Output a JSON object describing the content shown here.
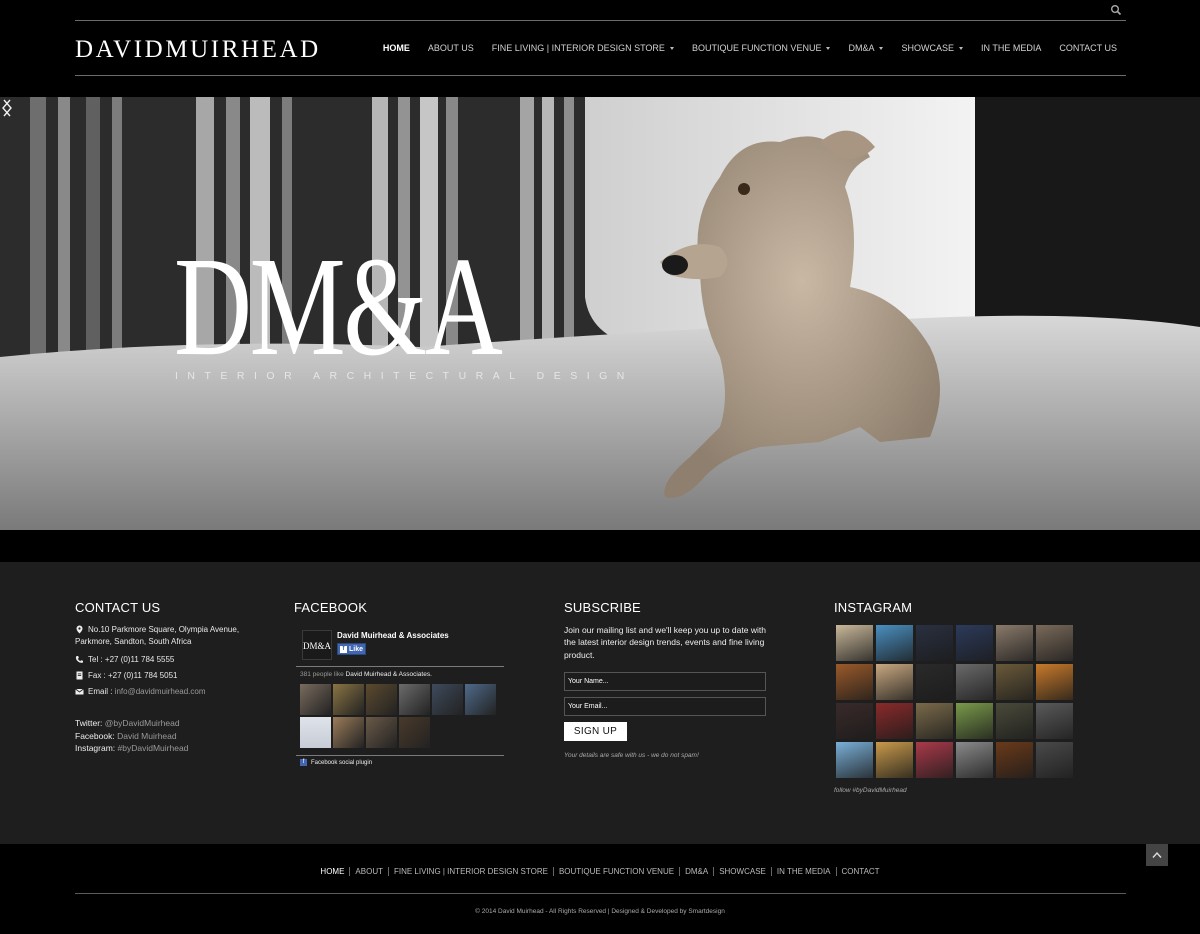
{
  "header": {
    "logo": "DAVIDMUIRHEAD",
    "nav": [
      {
        "label": "HOME",
        "active": true,
        "dropdown": false
      },
      {
        "label": "ABOUT US",
        "active": false,
        "dropdown": false
      },
      {
        "label": "FINE LIVING | INTERIOR DESIGN STORE",
        "active": false,
        "dropdown": true
      },
      {
        "label": "BOUTIQUE FUNCTION VENUE",
        "active": false,
        "dropdown": true
      },
      {
        "label": "DM&A",
        "active": false,
        "dropdown": true
      },
      {
        "label": "SHOWCASE",
        "active": false,
        "dropdown": true
      },
      {
        "label": "IN THE MEDIA",
        "active": false,
        "dropdown": false
      },
      {
        "label": "CONTACT US",
        "active": false,
        "dropdown": false
      }
    ]
  },
  "hero": {
    "title": "DM&A",
    "subtitle": "INTERIOR ARCHITECTURAL DESIGN"
  },
  "contact": {
    "title": "CONTACT US",
    "address": "No.10 Parkmore Square, Olympia Avenue,",
    "address2": "Parkmore, Sandton, South Africa",
    "tel": "Tel : +27 (0)11 784 5555",
    "fax": "Fax : +27 (0)11 784 5051",
    "email_label": "Email :",
    "email": "info@davidmuirhead.com",
    "twitter_label": "Twitter:",
    "twitter": "@byDavidMuirhead",
    "facebook_label": "Facebook:",
    "facebook": "David Muirhead",
    "instagram_label": "Instagram:",
    "instagram": "#byDavidMuirhead"
  },
  "facebook": {
    "title": "FACEBOOK",
    "logo_text": "DM&A",
    "page_name": "David Muirhead & Associates",
    "like_label": "Like",
    "count_text": "381 people like",
    "count_page": "David Muirhead & Associates.",
    "plugin_text": "Facebook social plugin",
    "face_colors": [
      "#7a6b5e",
      "#8a7444",
      "#5c4a2f",
      "#6b6b6b",
      "#3e4a5c",
      "#4f6a8a",
      "#c7ccd6",
      "#9c7c5a",
      "#6a5a48",
      "#4a3a2a"
    ]
  },
  "subscribe": {
    "title": "SUBSCRIBE",
    "text": "Join our mailing list and we'll keep you up to date with the latest interior design trends, events and fine living product.",
    "name_placeholder": "Your Name...",
    "email_placeholder": "Your Email...",
    "button": "SIGN UP",
    "note": "Your details are safe with us - we do not spam!"
  },
  "instagram": {
    "title": "INSTAGRAM",
    "follow": "follow #byDavidMuirhead",
    "tile_colors": [
      "#c9b89a",
      "#4a8fc0",
      "#2a3040",
      "#2c3a5a",
      "#8a7a6a",
      "#7a6a5a",
      "#9a5a2a",
      "#c8a880",
      "#2a2a2a",
      "#6a6a6a",
      "#6a5a3a",
      "#c87a2a",
      "#3a2a2a",
      "#8a2a2a",
      "#7a6a4a",
      "#7a9a4a",
      "#4a4a3a",
      "#5a5a5a",
      "#7ab0d8",
      "#c89a4a",
      "#aa3a4a",
      "#8a8a8a",
      "#6a3a1a",
      "#4a4a4a"
    ]
  },
  "footer": {
    "nav": [
      {
        "label": "HOME",
        "active": true
      },
      {
        "label": "ABOUT",
        "active": false
      },
      {
        "label": "FINE LIVING | INTERIOR DESIGN STORE",
        "active": false
      },
      {
        "label": "BOUTIQUE FUNCTION VENUE",
        "active": false
      },
      {
        "label": "DM&A",
        "active": false
      },
      {
        "label": "SHOWCASE",
        "active": false
      },
      {
        "label": "IN THE MEDIA",
        "active": false
      },
      {
        "label": "CONTACT",
        "active": false
      }
    ],
    "copyright": "© 2014 David Muirhead - All Rights Reserved  |  Designed & Developed by Smartdesign"
  }
}
